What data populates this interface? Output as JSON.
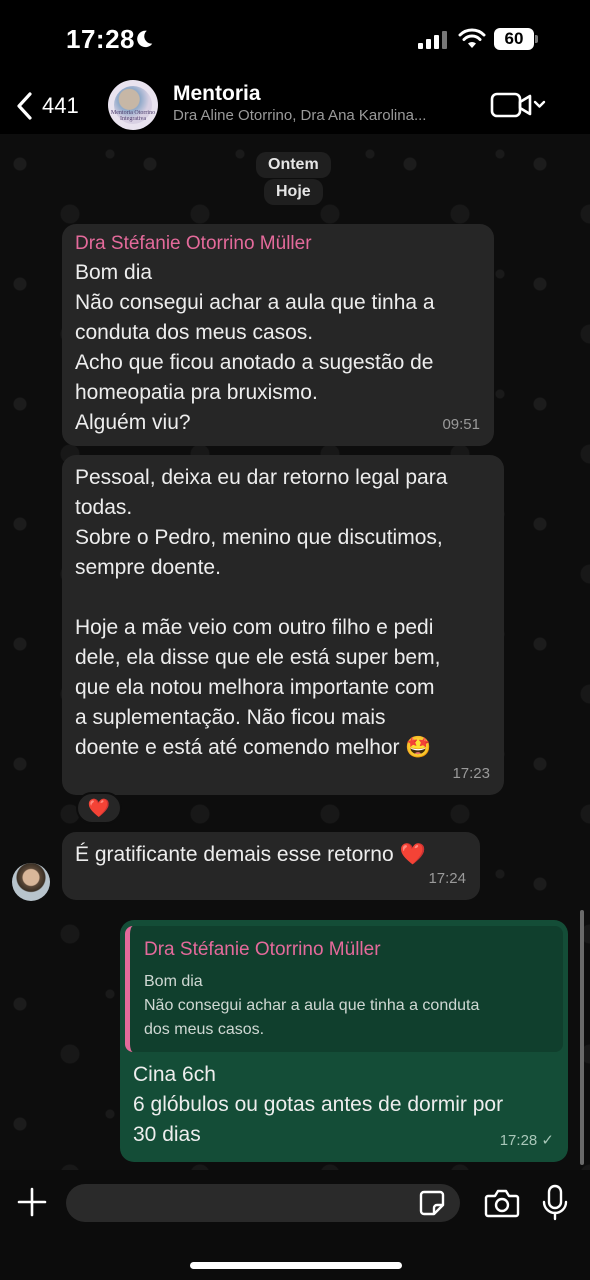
{
  "status_bar": {
    "time": "17:28",
    "battery": "60"
  },
  "header": {
    "back_count": "441",
    "title": "Mentoria",
    "subtitle": "Dra Aline Otorrino, Dra Ana Karolina...",
    "avatar_text": "Mentoria Otorrino Integrativa"
  },
  "dates": {
    "yesterday": "Ontem",
    "today": "Hoje"
  },
  "messages": [
    {
      "sender": "Dra Stéfanie Otorrino Müller",
      "lines": [
        "Bom dia",
        "Não consegui achar a aula que tinha a",
        "conduta dos meus casos.",
        "Acho que ficou anotado a sugestão de",
        "homeopatia pra bruxismo.",
        "Alguém viu?"
      ],
      "time": "09:51"
    },
    {
      "lines": [
        "Pessoal, deixa eu dar retorno legal para",
        "todas.",
        "Sobre o Pedro, menino que discutimos,",
        "sempre doente.",
        "Hoje a mãe veio com outro filho e pedi",
        "dele, ela disse que ele está super bem,",
        "que ela notou melhora importante com",
        "a suplementação. Não ficou mais",
        "doente e está até comendo melhor 🤩"
      ],
      "time": "17:23",
      "reaction": "❤️"
    },
    {
      "lines": [
        "É gratificante demais esse retorno ❤️"
      ],
      "time": "17:24"
    },
    {
      "quote": {
        "sender": "Dra Stéfanie Otorrino Müller",
        "lines": [
          "Bom dia",
          "Não consegui achar a aula que tinha a conduta",
          "dos meus casos."
        ]
      },
      "lines": [
        "Cina 6ch",
        "6 glóbulos ou gotas antes de dormir por",
        "30 dias"
      ],
      "time": "17:28 ✓"
    }
  ],
  "composer": {
    "placeholder": ""
  },
  "colors": {
    "sender": "#e46a9b",
    "outgoing": "#144d37",
    "incoming": "#262626"
  }
}
